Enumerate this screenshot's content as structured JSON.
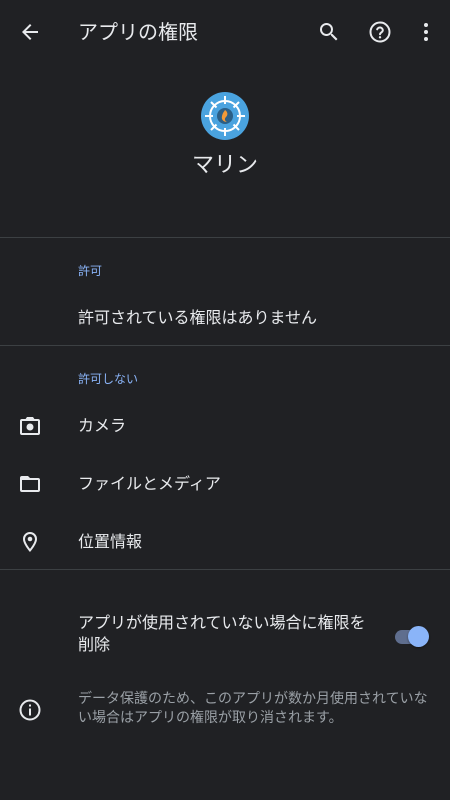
{
  "header": {
    "title": "アプリの権限",
    "back_icon": "arrow-back-icon",
    "search_icon": "search-icon",
    "help_icon": "help-icon",
    "more_icon": "more-vert-icon"
  },
  "app": {
    "name": "マリン",
    "icon": "app-icon",
    "icon_color": "#4aa3df"
  },
  "allowed": {
    "section_label": "許可",
    "empty_text": "許可されている権限はありません"
  },
  "not_allowed": {
    "section_label": "許可しない",
    "items": [
      {
        "label": "カメラ",
        "icon": "camera-icon"
      },
      {
        "label": "ファイルとメディア",
        "icon": "folder-icon"
      },
      {
        "label": "位置情報",
        "icon": "location-icon"
      }
    ]
  },
  "remove_permissions": {
    "label": "アプリが使用されていない場合に権限を削除",
    "enabled": true
  },
  "info": {
    "icon": "info-icon",
    "text": "データ保護のため、このアプリが数か月使用されていない場合はアプリの権限が取り消されます。"
  },
  "colors": {
    "background": "#202124",
    "accent": "#8ab4f8",
    "divider": "#3c4043"
  }
}
